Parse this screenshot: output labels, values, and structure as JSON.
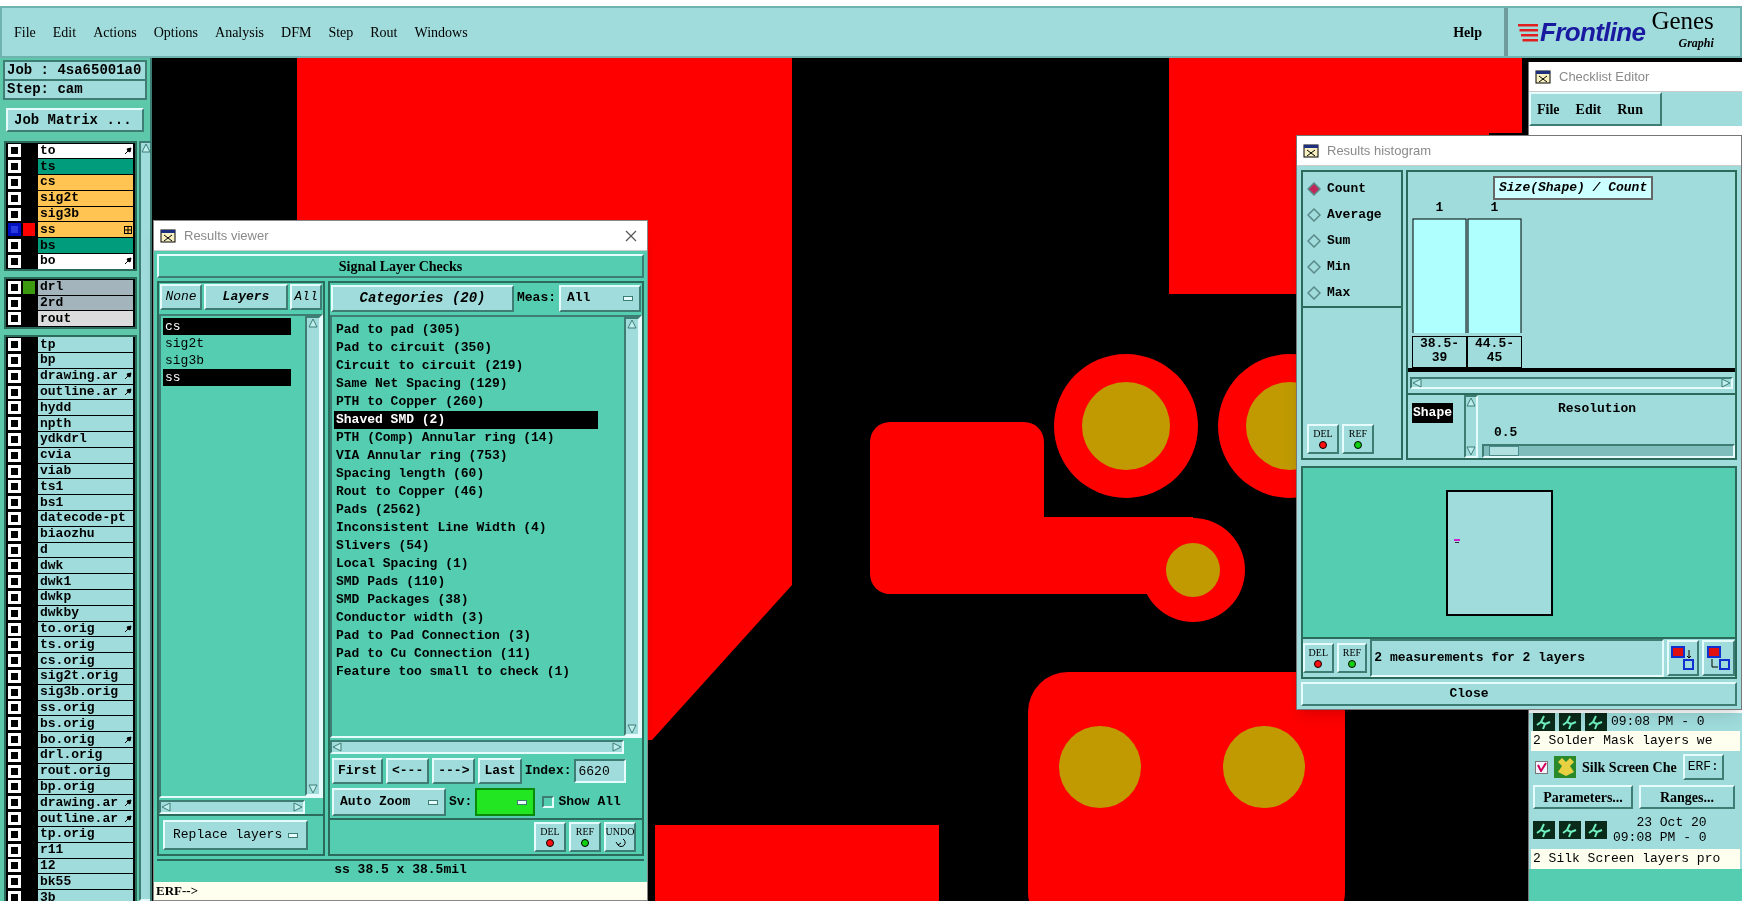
{
  "menu": [
    {
      "label": "File"
    },
    {
      "label": "Edit"
    },
    {
      "label": "Actions"
    },
    {
      "label": "Options"
    },
    {
      "label": "Analysis"
    },
    {
      "label": "DFM"
    },
    {
      "label": "Step"
    },
    {
      "label": "Rout"
    },
    {
      "label": "Windows"
    }
  ],
  "help": "Help",
  "logo": {
    "brand": "Frontline",
    "product": "Genes",
    "tagline": "Graphi"
  },
  "job_panel": {
    "job": "Job : 4sa65001a0",
    "step": "Step: cam",
    "matrix_button": "Job Matrix ...",
    "layer_groups": [
      {
        "layers": [
          {
            "name": "to",
            "color": "#ffffff",
            "selected": false,
            "kind": "arrow"
          },
          {
            "name": "ts",
            "color": "#009c7c",
            "selected": false,
            "kind": "plain"
          },
          {
            "name": "cs",
            "color": "#ffc452",
            "selected": false,
            "kind": "plain"
          },
          {
            "name": "sig2t",
            "color": "#ffc452",
            "selected": false,
            "kind": "plain"
          },
          {
            "name": "sig3b",
            "color": "#ffc452",
            "selected": false,
            "kind": "plain"
          },
          {
            "name": "ss",
            "color": "#ffc452",
            "selected": true,
            "swatch": {
              "color": "#ff0000"
            },
            "kind": "grid"
          },
          {
            "name": "bs",
            "color": "#009c7c",
            "selected": false,
            "kind": "plain"
          },
          {
            "name": "bo",
            "color": "#ffffff",
            "selected": false,
            "kind": "arrow"
          }
        ]
      },
      {
        "layers": [
          {
            "name": "drl",
            "color": "#a3b4bc",
            "selected": false,
            "swatch": {
              "color": "#3c9a10"
            },
            "kind": "plain"
          },
          {
            "name": "2rd",
            "color": "#a3b4bc",
            "selected": false,
            "kind": "plain"
          },
          {
            "name": "rout",
            "color": "#dcdcdc",
            "selected": false,
            "kind": "plain"
          }
        ]
      },
      {
        "layers": [
          {
            "name": "tp",
            "color": "#a0dcdc",
            "selected": false,
            "kind": "plain"
          },
          {
            "name": "bp",
            "color": "#a0dcdc",
            "selected": false,
            "kind": "plain"
          },
          {
            "name": "drawing.ar",
            "color": "#a0dcdc",
            "selected": false,
            "kind": "arrow"
          },
          {
            "name": "outline.ar",
            "color": "#a0dcdc",
            "selected": false,
            "kind": "arrow"
          },
          {
            "name": "hydd",
            "color": "#a0dcdc",
            "selected": false,
            "kind": "plain"
          },
          {
            "name": "npth",
            "color": "#a0dcdc",
            "selected": false,
            "kind": "plain"
          },
          {
            "name": "ydkdrl",
            "color": "#a0dcdc",
            "selected": false,
            "kind": "plain"
          },
          {
            "name": "cvia",
            "color": "#a0dcdc",
            "selected": false,
            "kind": "plain"
          },
          {
            "name": "viab",
            "color": "#a0dcdc",
            "selected": false,
            "kind": "plain"
          },
          {
            "name": "ts1",
            "color": "#a0dcdc",
            "selected": false,
            "kind": "plain"
          },
          {
            "name": "bs1",
            "color": "#a0dcdc",
            "selected": false,
            "kind": "plain"
          },
          {
            "name": "datecode-pt",
            "color": "#a0dcdc",
            "selected": false,
            "kind": "plain"
          },
          {
            "name": "biaozhu",
            "color": "#a0dcdc",
            "selected": false,
            "kind": "plain"
          },
          {
            "name": "d",
            "color": "#a0dcdc",
            "selected": false,
            "kind": "plain"
          },
          {
            "name": "dwk",
            "color": "#a0dcdc",
            "selected": false,
            "kind": "plain"
          },
          {
            "name": "dwk1",
            "color": "#a0dcdc",
            "selected": false,
            "kind": "plain"
          },
          {
            "name": "dwkp",
            "color": "#a0dcdc",
            "selected": false,
            "kind": "plain"
          },
          {
            "name": "dwkby",
            "color": "#a0dcdc",
            "selected": false,
            "kind": "plain"
          },
          {
            "name": "to.orig",
            "color": "#a0dcdc",
            "selected": false,
            "kind": "arrow"
          },
          {
            "name": "ts.orig",
            "color": "#a0dcdc",
            "selected": false,
            "kind": "plain"
          },
          {
            "name": "cs.orig",
            "color": "#a0dcdc",
            "selected": false,
            "kind": "plain"
          },
          {
            "name": "sig2t.orig",
            "color": "#a0dcdc",
            "selected": false,
            "kind": "plain"
          },
          {
            "name": "sig3b.orig",
            "color": "#a0dcdc",
            "selected": false,
            "kind": "plain"
          },
          {
            "name": "ss.orig",
            "color": "#a0dcdc",
            "selected": false,
            "kind": "plain"
          },
          {
            "name": "bs.orig",
            "color": "#a0dcdc",
            "selected": false,
            "kind": "plain"
          },
          {
            "name": "bo.orig",
            "color": "#a0dcdc",
            "selected": false,
            "kind": "arrow"
          },
          {
            "name": "drl.orig",
            "color": "#a0dcdc",
            "selected": false,
            "kind": "plain"
          },
          {
            "name": "rout.orig",
            "color": "#a0dcdc",
            "selected": false,
            "kind": "plain"
          },
          {
            "name": "bp.orig",
            "color": "#a0dcdc",
            "selected": false,
            "kind": "plain"
          },
          {
            "name": "drawing.ar",
            "color": "#a0dcdc",
            "selected": false,
            "kind": "arrow"
          },
          {
            "name": "outline.ar",
            "color": "#a0dcdc",
            "selected": false,
            "kind": "arrow"
          },
          {
            "name": "tp.orig",
            "color": "#a0dcdc",
            "selected": false,
            "kind": "plain"
          },
          {
            "name": "r11",
            "color": "#a0dcdc",
            "selected": false,
            "kind": "plain"
          },
          {
            "name": "12",
            "color": "#a0dcdc",
            "selected": false,
            "kind": "plain"
          },
          {
            "name": "bk55",
            "color": "#a0dcdc",
            "selected": false,
            "kind": "plain"
          },
          {
            "name": "3b",
            "color": "#a0dcdc",
            "selected": false,
            "kind": "plain"
          }
        ]
      }
    ]
  },
  "results_viewer": {
    "title": "Results viewer",
    "header": "Signal Layer Checks",
    "layer_buttons": [
      "None",
      "Layers",
      "All"
    ],
    "layers": [
      {
        "name": "cs",
        "selected": true
      },
      {
        "name": "sig2t",
        "selected": false
      },
      {
        "name": "sig3b",
        "selected": false
      },
      {
        "name": "ss",
        "selected": true
      }
    ],
    "replace_button": "Replace layers",
    "categories_button": "Categories (20)",
    "meas_label": "Meas:",
    "meas_value": "All",
    "categories": [
      {
        "label": "Pad to pad (305)",
        "selected": false
      },
      {
        "label": "Pad to circuit (350)",
        "selected": false
      },
      {
        "label": "Circuit to circuit (219)",
        "selected": false
      },
      {
        "label": "Same Net Spacing (129)",
        "selected": false
      },
      {
        "label": "PTH to Copper (260)",
        "selected": false
      },
      {
        "label": "Shaved SMD (2)",
        "selected": true
      },
      {
        "label": "PTH (Comp) Annular ring (14)",
        "selected": false
      },
      {
        "label": "VIA Annular ring (753)",
        "selected": false
      },
      {
        "label": "Spacing length (60)",
        "selected": false
      },
      {
        "label": "Rout to Copper (46)",
        "selected": false
      },
      {
        "label": "Pads (2562)",
        "selected": false
      },
      {
        "label": "Inconsistent Line Width (4)",
        "selected": false
      },
      {
        "label": "Slivers (54)",
        "selected": false
      },
      {
        "label": "Local Spacing (1)",
        "selected": false
      },
      {
        "label": "SMD Pads (110)",
        "selected": false
      },
      {
        "label": "SMD Packages (38)",
        "selected": false
      },
      {
        "label": "Conductor width (3)",
        "selected": false
      },
      {
        "label": "Pad to Pad Connection (3)",
        "selected": false
      },
      {
        "label": "Pad to Cu Connection (11)",
        "selected": false
      },
      {
        "label": "Feature too small to check (1)",
        "selected": false
      }
    ],
    "nav_buttons": [
      "First",
      "<---",
      "--->",
      "Last"
    ],
    "index_label": "Index:",
    "index_value": "6620",
    "zoom_button": "Auto Zoom",
    "sv_label": "Sv:",
    "sv": {
      "color": "#22e622"
    },
    "show_all": {
      "label": "Show All",
      "checked": false
    },
    "tool_buttons": [
      "DEL",
      "REF",
      "UNDO"
    ],
    "status": "ss 38.5 x 38.5mil",
    "command_prompt": "ERF-->"
  },
  "histogram": {
    "title": "Results histogram",
    "modes": [
      {
        "label": "Count",
        "selected": true
      },
      {
        "label": "Average",
        "selected": false
      },
      {
        "label": "Sum",
        "selected": false
      },
      {
        "label": "Min",
        "selected": false
      },
      {
        "label": "Max",
        "selected": false
      }
    ],
    "chart_data": {
      "type": "bar",
      "title": "Size(Shape) / Count",
      "categories": [
        "38.5-39",
        "44.5-45"
      ],
      "values": [
        1,
        1
      ],
      "value_labels": [
        "1",
        "1"
      ]
    },
    "side_buttons": [
      "DEL",
      "REF"
    ],
    "shape_label": "Shape",
    "resolution_label": "Resolution",
    "resolution_value": "0.5",
    "resolution": {
      "level": 0.02
    },
    "status_buttons": [
      "DEL",
      "REF"
    ],
    "status": "2 measurements for 2 layers",
    "close": "Close"
  },
  "checklist": {
    "title": "Checklist Editor",
    "menu": [
      "File",
      "Edit",
      "Run"
    ],
    "time_1": "09:08 PM - 0",
    "message_1": "2 Solder Mask layers we",
    "check": {
      "checked": true,
      "label": "Silk Screen Che"
    },
    "erf_button": "ERF:",
    "buttons": [
      "Parameters...",
      "Ranges..."
    ],
    "date": "23 Oct 20",
    "time_2": "09:08 PM - 0",
    "message_2": "2 Silk Screen layers pro"
  }
}
